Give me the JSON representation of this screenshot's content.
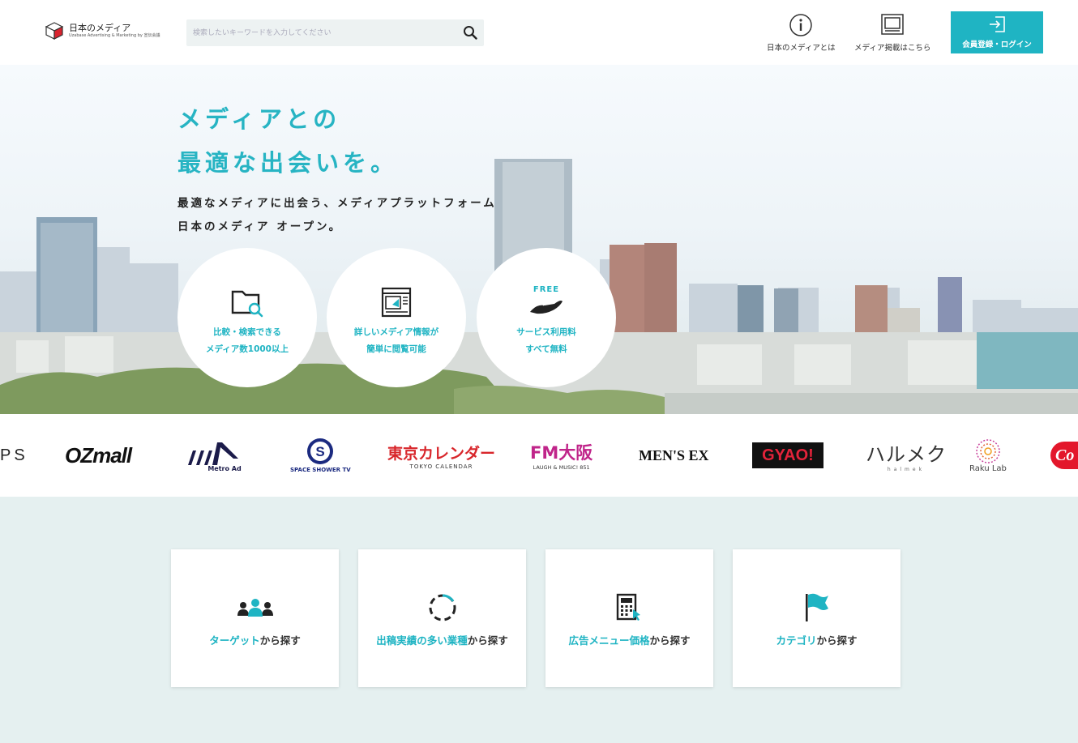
{
  "header": {
    "logo_title": "日本のメディア",
    "logo_sub": "Uzabase Advertising & Marketing  by 宣伝会議",
    "search_placeholder": "検索したいキーワードを入力してください",
    "nav_about": "日本のメディアとは",
    "nav_listing": "メディア掲載はこちら",
    "login": "会員登録・ログイン"
  },
  "hero": {
    "title_line1": "メディアとの",
    "title_line2": "最適な出会いを。",
    "desc_line1": "最適なメディアに出会う、メディアプラットフォーム",
    "desc_line2": "日本のメディア オープン。",
    "features": [
      {
        "icon": "folder-search-icon",
        "line1": "比較・検索できる",
        "line2": "メディア数1000以上"
      },
      {
        "icon": "media-info-icon",
        "line1": "詳しいメディア情報が",
        "line2": "簡単に閲覧可能"
      },
      {
        "icon": "free-hand-icon",
        "badge": "FREE",
        "line1": "サービス利用料",
        "line2": "すべて無料"
      }
    ]
  },
  "brands": {
    "ps": "PS",
    "ozmall": "OZmall",
    "metro": "Metro Ad",
    "spaceshower": "SPACE SHOWER TV",
    "tokyo_cal": "東京カレンダー",
    "tokyo_cal_sub": "TOKYO CALENDAR",
    "fm_osaka": "FM大阪",
    "fm_osaka_sub": "LAUGH & MUSIC! 851",
    "mensex": "MEN'S EX",
    "gyao": "GYAO!",
    "halmek": "ハルメク",
    "halmek_sub": "halmek",
    "rakulab": "Raku Lab",
    "cola": "Co"
  },
  "categories": [
    {
      "highlight": "ターゲット",
      "rest": "から探す",
      "icon": "people-icon"
    },
    {
      "highlight": "出稿実績の多い業種",
      "rest": "から探す",
      "icon": "dashed-circle-icon"
    },
    {
      "highlight": "広告メニュー価格",
      "rest": "から探す",
      "icon": "calculator-icon"
    },
    {
      "highlight": "カテゴリ",
      "rest": "から探す",
      "icon": "flag-icon"
    }
  ],
  "colors": {
    "accent": "#1fb4c3",
    "section_bg": "#e5f0f0"
  }
}
